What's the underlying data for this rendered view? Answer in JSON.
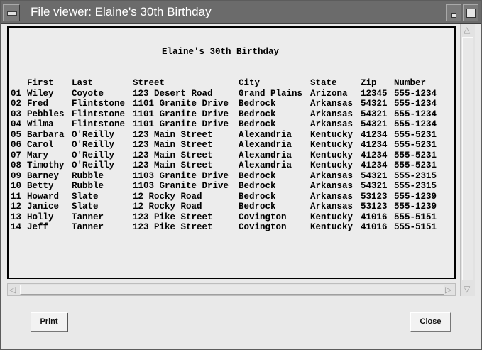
{
  "window": {
    "title": "File viewer: Elaine's 30th Birthday"
  },
  "document": {
    "heading": "Elaine's 30th Birthday",
    "columns": [
      "",
      "First",
      "Last",
      "Street",
      "City",
      "State",
      "Zip",
      "Number"
    ],
    "rows": [
      [
        "01",
        "Wiley",
        "Coyote",
        "123 Desert Road",
        "Grand Plains",
        "Arizona",
        "12345",
        "555-1234"
      ],
      [
        "02",
        "Fred",
        "Flintstone",
        "1101 Granite Drive",
        "Bedrock",
        "Arkansas",
        "54321",
        "555-1234"
      ],
      [
        "03",
        "Pebbles",
        "Flintstone",
        "1101 Granite Drive",
        "Bedrock",
        "Arkansas",
        "54321",
        "555-1234"
      ],
      [
        "04",
        "Wilma",
        "Flintstone",
        "1101 Granite Drive",
        "Bedrock",
        "Arkansas",
        "54321",
        "555-1234"
      ],
      [
        "05",
        "Barbara",
        "O'Reilly",
        "123 Main Street",
        "Alexandria",
        "Kentucky",
        "41234",
        "555-5231"
      ],
      [
        "06",
        "Carol",
        "O'Reilly",
        "123 Main Street",
        "Alexandria",
        "Kentucky",
        "41234",
        "555-5231"
      ],
      [
        "07",
        "Mary",
        "O'Reilly",
        "123 Main Street",
        "Alexandria",
        "Kentucky",
        "41234",
        "555-5231"
      ],
      [
        "08",
        "Timothy",
        "O'Reilly",
        "123 Main Street",
        "Alexandria",
        "Kentucky",
        "41234",
        "555-5231"
      ],
      [
        "09",
        "Barney",
        "Rubble",
        "1103 Granite Drive",
        "Bedrock",
        "Arkansas",
        "54321",
        "555-2315"
      ],
      [
        "10",
        "Betty",
        "Rubble",
        "1103 Granite Drive",
        "Bedrock",
        "Arkansas",
        "54321",
        "555-2315"
      ],
      [
        "11",
        "Howard",
        "Slate",
        "12 Rocky Road",
        "Bedrock",
        "Arkansas",
        "53123",
        "555-1239"
      ],
      [
        "12",
        "Janice",
        "Slate",
        "12 Rocky Road",
        "Bedrock",
        "Arkansas",
        "53123",
        "555-1239"
      ],
      [
        "13",
        "Holly",
        "Tanner",
        "123 Pike Street",
        "Covington",
        "Kentucky",
        "41016",
        "555-5151"
      ],
      [
        "14",
        "Jeff",
        "Tanner",
        "123 Pike Street",
        "Covington",
        "Kentucky",
        "41016",
        "555-5151"
      ]
    ]
  },
  "buttons": {
    "print": "Print",
    "close": "Close"
  },
  "icons": {
    "window_menu": "window-menu-icon",
    "minimize": "minimize-icon",
    "maximize": "maximize-icon",
    "arrow_up": "arrow-up-icon",
    "arrow_down": "arrow-down-icon",
    "arrow_left": "arrow-left-icon",
    "arrow_right": "arrow-right-icon"
  },
  "colors": {
    "titlebar": "#6b6b6b",
    "window_bg": "#e9e9e9",
    "text": "#000000"
  }
}
